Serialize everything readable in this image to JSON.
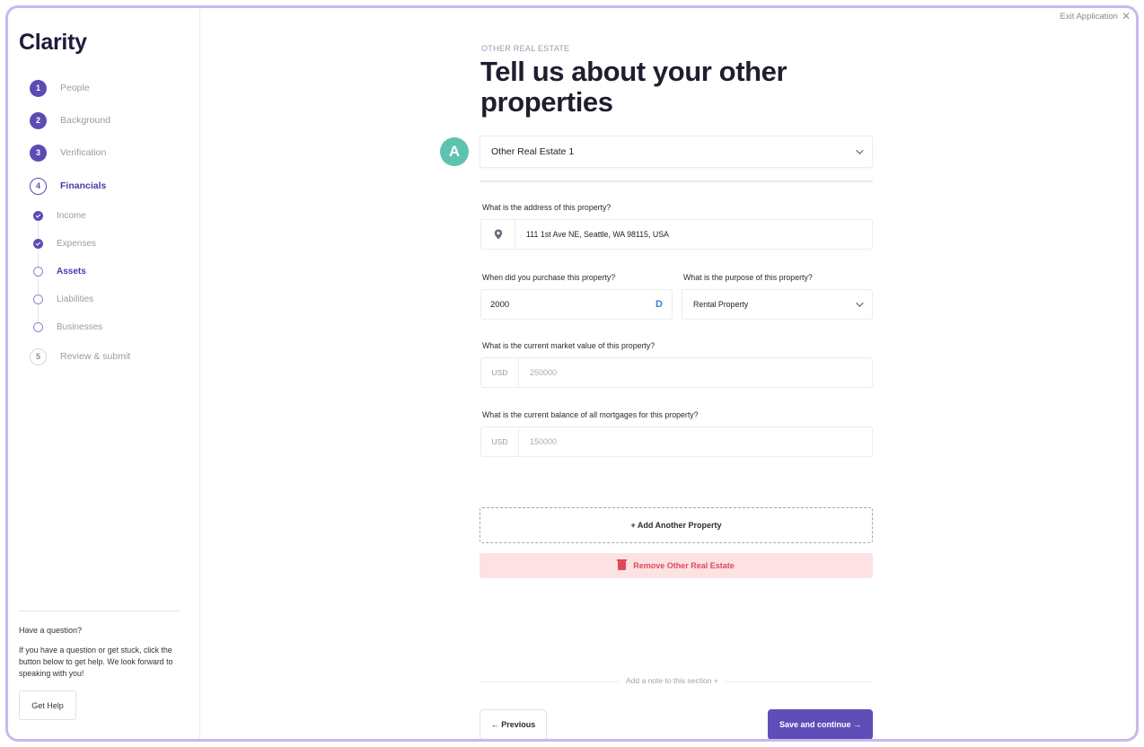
{
  "sidebar": {
    "logo": "Clarity",
    "steps": [
      {
        "num": "1",
        "label": "People"
      },
      {
        "num": "2",
        "label": "Background"
      },
      {
        "num": "3",
        "label": "Verification"
      },
      {
        "num": "4",
        "label": "Financials"
      },
      {
        "num": "5",
        "label": "Review & submit"
      }
    ],
    "substeps": [
      {
        "label": "Income"
      },
      {
        "label": "Expenses"
      },
      {
        "label": "Assets"
      },
      {
        "label": "Liabilities"
      },
      {
        "label": "Businesses"
      }
    ],
    "help": {
      "title": "Have a question?",
      "text": "If you have a question or get stuck, click the button below to get help. We look forward to speaking with you!",
      "button": "Get Help"
    }
  },
  "header": {
    "exit_label": "Exit Application",
    "exit_icon": "close-icon"
  },
  "main": {
    "eyebrow": "OTHER REAL ESTATE",
    "title": "Tell us about your other properties",
    "badge": "A",
    "property_select": {
      "value": "Other Real Estate 1",
      "icon": "chevron-down-icon"
    },
    "address": {
      "label": "What is the address of this property?",
      "value": "111 1st Ave NE, Seattle, WA 98115, USA",
      "icon": "location-pin-icon"
    },
    "purchase": {
      "label": "When did you purchase this property?",
      "value": "2000",
      "icon": "calendar-icon"
    },
    "purpose": {
      "label": "What is the purpose of this property?",
      "value": "Rental Property"
    },
    "market_value": {
      "label": "What is the current market value of this property?",
      "prefix": "USD",
      "value": "250000"
    },
    "mortgage_balance": {
      "label": "What is the current balance of all mortgages for this property?",
      "prefix": "USD",
      "value": "150000"
    },
    "add_property_label": "+ Add Another Property",
    "remove_label": "Remove Other Real Estate",
    "note_label": "Add a note to this section +",
    "previous_label": "← Previous",
    "save_label": "Save and continue →"
  },
  "colors": {
    "accent": "#5f4db8",
    "badge": "#5ec2b0",
    "danger": "#e0485a",
    "danger_bg": "#fde2e4",
    "frame": "#c9b8ee"
  }
}
